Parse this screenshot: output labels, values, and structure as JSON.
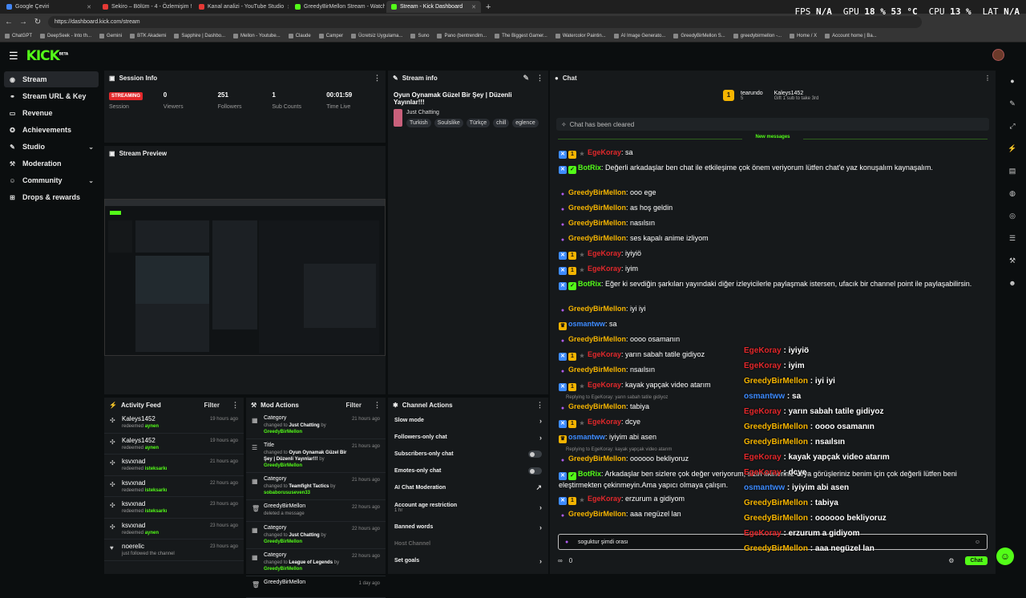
{
  "browser": {
    "tabs": [
      {
        "label": "Google Çeviri",
        "color": "#4285f4",
        "active": false
      },
      {
        "label": "Sekiro – Bölüm - 4 - Özlemişim !!!!",
        "color": "#e53935",
        "active": false
      },
      {
        "label": "Kanal analizi - YouTube Studio",
        "color": "#e53935",
        "active": false
      },
      {
        "label": "GreedyBirMellon Stream - Watch L...",
        "color": "#53fc18",
        "active": false
      },
      {
        "label": "Stream - Kick Dashboard",
        "color": "#53fc18",
        "active": true
      }
    ],
    "url": "https://dashboard.kick.com/stream",
    "bookmarks": [
      "ChatGPT",
      "DeepSeek - Into th...",
      "Gemini",
      "BTK Akademi",
      "Sapphire | Dashbo...",
      "Mellon - Youtube...",
      "Claude",
      "Camper",
      "Ücretsiz Uygulama...",
      "Suno",
      "Pano (bentrendim...",
      "The Biggest Gamer...",
      "Watercolor Paintin...",
      "AI Image Generato...",
      "GreedyBirMellon S...",
      "greedybirmellon -...",
      "Home / X",
      "Account home | Ba..."
    ]
  },
  "hud": {
    "fps_label": "FPS",
    "fps": "N/A",
    "gpu_label": "GPU",
    "gpu": "18 % 53 °C",
    "cpu_label": "CPU",
    "cpu": "13 %",
    "lat_label": "LAT",
    "lat": "N/A"
  },
  "header": {
    "logo": "KICK",
    "logo_badge": "BETA"
  },
  "sidebar": {
    "items": [
      {
        "label": "Stream",
        "icon": "radio-icon",
        "glyph": "◉",
        "active": true
      },
      {
        "label": "Stream URL & Key",
        "icon": "link-icon",
        "glyph": "⚭",
        "active": false
      },
      {
        "label": "Revenue",
        "icon": "wallet-icon",
        "glyph": "▭",
        "active": false
      },
      {
        "label": "Achievements",
        "icon": "trophy-icon",
        "glyph": "✪",
        "active": false
      },
      {
        "label": "Studio",
        "icon": "brush-icon",
        "glyph": "✎",
        "active": false,
        "expandable": true
      },
      {
        "label": "Moderation",
        "icon": "wrench-icon",
        "glyph": "⚒",
        "active": false
      },
      {
        "label": "Community",
        "icon": "people-icon",
        "glyph": "☺",
        "active": false,
        "expandable": true
      },
      {
        "label": "Drops & rewards",
        "icon": "gift-icon",
        "glyph": "⊞",
        "active": false
      }
    ]
  },
  "session": {
    "title": "Session Info",
    "status": "STREAMING",
    "stats": [
      {
        "value": "",
        "label": "Session"
      },
      {
        "value": "0",
        "label": "Viewers"
      },
      {
        "value": "251",
        "label": "Followers"
      },
      {
        "value": "1",
        "label": "Sub Counts"
      },
      {
        "value": "00:01:59",
        "label": "Time Live"
      }
    ]
  },
  "preview": {
    "title": "Stream Preview"
  },
  "stream_info": {
    "title": "Stream info",
    "stream_title": "Oyun Oynamak Güzel Bir Şey | Düzenli Yayınlar!!!",
    "category": "Just Chatting",
    "tags": [
      "Turkish",
      "Soulslike",
      "Türkçe",
      "chill",
      "eglence"
    ]
  },
  "activity": {
    "title": "Activity Feed",
    "filter": "Filter",
    "items": [
      {
        "name": "Kaleys1452",
        "action": "redeemed",
        "detail": "aynen",
        "time": "19 hours ago",
        "icon": "reward-icon"
      },
      {
        "name": "Kaleys1452",
        "action": "redeemed",
        "detail": "aynen",
        "time": "19 hours ago",
        "icon": "reward-icon"
      },
      {
        "name": "ksvxnad",
        "action": "redeemed",
        "detail": "isteksarkı",
        "time": "21 hours ago",
        "icon": "reward-icon"
      },
      {
        "name": "ksvxnad",
        "action": "redeemed",
        "detail": "isteksarkı",
        "time": "22 hours ago",
        "icon": "reward-icon"
      },
      {
        "name": "ksvxnad",
        "action": "redeemed",
        "detail": "isteksarkı",
        "time": "23 hours ago",
        "icon": "reward-icon"
      },
      {
        "name": "ksvxnad",
        "action": "redeemed",
        "detail": "aynen",
        "time": "23 hours ago",
        "icon": "reward-icon"
      },
      {
        "name": "noerelic",
        "action": "just followed the channel",
        "detail": "",
        "time": "23 hours ago",
        "icon": "heart-icon"
      }
    ]
  },
  "mod_actions": {
    "title": "Mod Actions",
    "filter": "Filter",
    "items": [
      {
        "title": "Category",
        "pre": "changed to",
        "value": "Just Chatting",
        "by": "by",
        "user": "GreedyBirMellon",
        "time": "21 hours ago"
      },
      {
        "title": "Title",
        "pre": "changed to",
        "value": "Oyun Oynamak Güzel Bir Şey | Düzenli Yayınlar!!!",
        "by": "by",
        "user": "GreedyBirMellon",
        "time": "21 hours ago"
      },
      {
        "title": "Category",
        "pre": "changed to",
        "value": "Teamfight Tactics",
        "by": "by",
        "user": "sobaborususeven33",
        "time": "21 hours ago"
      },
      {
        "title": "GreedyBirMellon",
        "pre": "deleted a message",
        "value": "",
        "by": "",
        "user": "",
        "time": "22 hours ago"
      },
      {
        "title": "Category",
        "pre": "changed to",
        "value": "Just Chatting",
        "by": "by",
        "user": "GreedyBirMellon",
        "time": "22 hours ago"
      },
      {
        "title": "Category",
        "pre": "changed to",
        "value": "League of Legends",
        "by": "by",
        "user": "GreedyBirMellon",
        "time": "22 hours ago"
      },
      {
        "title": "GreedyBirMellon",
        "pre": "",
        "value": "",
        "by": "",
        "user": "",
        "time": "1 day ago"
      }
    ]
  },
  "channel_actions": {
    "title": "Channel Actions",
    "items": [
      {
        "label": "Slow mode",
        "control": "chevron"
      },
      {
        "label": "Followers-only chat",
        "control": "chevron"
      },
      {
        "label": "Subscribers-only chat",
        "control": "toggle"
      },
      {
        "label": "Emotes-only chat",
        "control": "toggle"
      },
      {
        "label": "AI Chat Moderation",
        "control": "external"
      },
      {
        "label": "Account age restriction",
        "sub": "1 hr",
        "control": "chevron"
      },
      {
        "label": "Banned words",
        "control": "chevron"
      },
      {
        "label": "Host Channel",
        "control": "none",
        "disabled": true
      },
      {
        "label": "Set goals",
        "control": "chevron"
      }
    ]
  },
  "chat": {
    "title": "Chat",
    "gift_user": "tearundo",
    "gift_count": "5",
    "gift_target": "Kaleys1452",
    "gift_cta": "Gift 1 sub to take 3rd",
    "cleared": "Chat has been cleared",
    "new_messages": "New messages",
    "messages": [
      {
        "user": "EgeKoray",
        "color": "#e3282b",
        "badges": [
          "blue",
          "gold",
          "grey"
        ],
        "text": ": sa"
      },
      {
        "user": "BotRix",
        "color": "#53fc18",
        "badges": [
          "blue",
          "green"
        ],
        "text": ": Değerli arkadaşlar ben chat ile etkileşime çok önem veriyorum lütfen chat'e yaz konuşalım kaynaşalım."
      },
      {
        "user": "GreedyBirMellon",
        "color": "#f5b400",
        "badges": [
          "mic"
        ],
        "text": ": ooo ege"
      },
      {
        "user": "GreedyBirMellon",
        "color": "#f5b400",
        "badges": [
          "mic"
        ],
        "text": ": as hoş geldin"
      },
      {
        "user": "GreedyBirMellon",
        "color": "#f5b400",
        "badges": [
          "mic"
        ],
        "text": ": nasılsın"
      },
      {
        "user": "GreedyBirMellon",
        "color": "#f5b400",
        "badges": [
          "mic"
        ],
        "text": ": ses kapalı anime izliyom"
      },
      {
        "user": "EgeKoray",
        "color": "#e3282b",
        "badges": [
          "blue",
          "gold",
          "grey"
        ],
        "text": ": iyiyiö"
      },
      {
        "user": "EgeKoray",
        "color": "#e3282b",
        "badges": [
          "blue",
          "gold",
          "grey"
        ],
        "text": ": iyim"
      },
      {
        "user": "BotRix",
        "color": "#53fc18",
        "badges": [
          "blue",
          "green"
        ],
        "text": ": Eğer ki sevdiğin şarkıları yayındaki diğer izleyicilerle paylaşmak istersen, ufacık bir channel point ile paylaşabilirsin."
      },
      {
        "user": "GreedyBirMellon",
        "color": "#f5b400",
        "badges": [
          "mic"
        ],
        "text": ": iyi iyi"
      },
      {
        "user": "osmantww",
        "color": "#3d8bff",
        "badges": [
          "crown"
        ],
        "text": ": sa"
      },
      {
        "user": "GreedyBirMellon",
        "color": "#f5b400",
        "badges": [
          "mic"
        ],
        "text": ": oooo osamanın"
      },
      {
        "user": "EgeKoray",
        "color": "#e3282b",
        "badges": [
          "blue",
          "gold",
          "grey"
        ],
        "text": ": yarın sabah tatile gidiyoz"
      },
      {
        "user": "GreedyBirMellon",
        "color": "#f5b400",
        "badges": [
          "mic"
        ],
        "text": ": nsaılsın"
      },
      {
        "user": "EgeKoray",
        "color": "#e3282b",
        "badges": [
          "blue",
          "gold",
          "grey"
        ],
        "text": ": kayak yapçak video atarım"
      },
      {
        "user": "GreedyBirMellon",
        "color": "#f5b400",
        "badges": [
          "mic"
        ],
        "text": ": tabiya",
        "reply": "Replying to EgeKoray: yarın sabah tatile gidiyoz"
      },
      {
        "user": "EgeKoray",
        "color": "#e3282b",
        "badges": [
          "blue",
          "gold",
          "grey"
        ],
        "text": ": dcye"
      },
      {
        "user": "osmantww",
        "color": "#3d8bff",
        "badges": [
          "crown"
        ],
        "text": ": iyiyim abi asen"
      },
      {
        "user": "GreedyBirMellon",
        "color": "#f5b400",
        "badges": [
          "mic"
        ],
        "text": ": oooooo bekliyoruz",
        "reply": "Replying to EgeKoray: kayak yapçak video atarım"
      },
      {
        "user": "BotRix",
        "color": "#53fc18",
        "badges": [
          "blue",
          "green"
        ],
        "text": ": Arkadaşlar ben sizlere çok değer veriyorum, sizin fikirleriniz veya görüşleriniz benim için çok değerli lütfen beni eleştirmekten çekinmeyin.Ama yapıcı olmaya çalışın."
      },
      {
        "user": "EgeKoray",
        "color": "#e3282b",
        "badges": [
          "blue",
          "gold",
          "grey"
        ],
        "text": ": erzurum a gidiyom"
      },
      {
        "user": "GreedyBirMellon",
        "color": "#f5b400",
        "badges": [
          "mic"
        ],
        "text": ": aaa negüzel lan"
      }
    ],
    "input_value": "soguktur şimdi orası",
    "points": "0",
    "send_label": "Chat"
  },
  "overlay": {
    "messages": [
      {
        "user": "EgeKoray",
        "color": "#e3282b",
        "text": " : iyiyiö"
      },
      {
        "user": "EgeKoray",
        "color": "#e3282b",
        "text": " : iyim"
      },
      {
        "user": "GreedyBirMellon",
        "color": "#f5b400",
        "text": " : iyi iyi"
      },
      {
        "user": "osmantww",
        "color": "#3d8bff",
        "text": " : sa"
      },
      {
        "user": "EgeKoray",
        "color": "#e3282b",
        "text": " : yarın sabah tatile gidiyoz"
      },
      {
        "user": "GreedyBirMellon",
        "color": "#f5b400",
        "text": " : oooo osamanın"
      },
      {
        "user": "GreedyBirMellon",
        "color": "#f5b400",
        "text": " : nsaılsın"
      },
      {
        "user": "EgeKoray",
        "color": "#e3282b",
        "text": " : kayak yapçak video atarım"
      },
      {
        "user": "EgeKoray",
        "color": "#e3282b",
        "text": " : dcye"
      },
      {
        "user": "osmantww",
        "color": "#3d8bff",
        "text": " : iyiyim abi asen"
      },
      {
        "user": "GreedyBirMellon",
        "color": "#f5b400",
        "text": " : tabiya"
      },
      {
        "user": "GreedyBirMellon",
        "color": "#f5b400",
        "text": " : oooooo bekliyoruz"
      },
      {
        "user": "EgeKoray",
        "color": "#e3282b",
        "text": " : erzurum a gidiyom"
      },
      {
        "user": "GreedyBirMellon",
        "color": "#f5b400",
        "text": " : aaa negüzel lan"
      }
    ]
  },
  "colors": {
    "accent": "#53fc18",
    "live": "#e3282b",
    "panel": "#16191b",
    "bg": "#0b0e0f"
  }
}
